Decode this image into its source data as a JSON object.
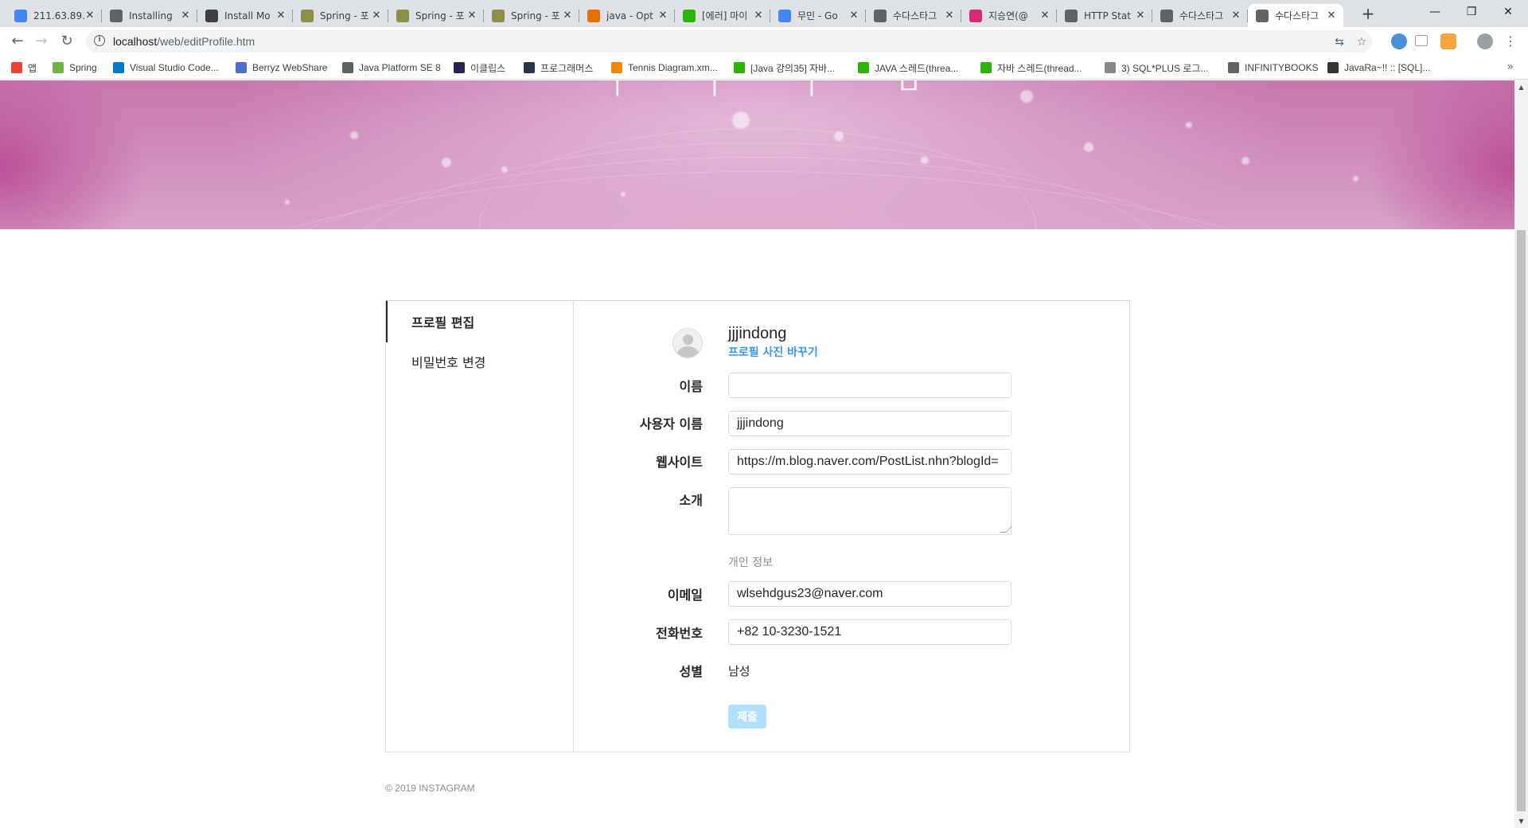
{
  "browser": {
    "tabs": [
      {
        "title": "211.63.89.",
        "icon": "chrome-icon",
        "color": "#4285f4"
      },
      {
        "title": "Installing",
        "icon": "globe-icon",
        "color": "#5f6368"
      },
      {
        "title": "Install Mo",
        "icon": "mongodb-icon",
        "color": "#3f3f3f"
      },
      {
        "title": "Spring - 포",
        "icon": "spring-icon",
        "color": "#8b8f4a"
      },
      {
        "title": "Spring - 포",
        "icon": "spring-icon",
        "color": "#8b8f4a"
      },
      {
        "title": "Spring - 포",
        "icon": "spring-icon",
        "color": "#8b8f4a"
      },
      {
        "title": "java - Opt",
        "icon": "java-icon",
        "color": "#e76f00"
      },
      {
        "title": "[에러] 마이",
        "icon": "blog-icon",
        "color": "#2db400"
      },
      {
        "title": "무민 - Go",
        "icon": "google-icon",
        "color": "#4285f4"
      },
      {
        "title": "수다스타그",
        "icon": "globe-icon",
        "color": "#5f6368"
      },
      {
        "title": "지승연(@",
        "icon": "instagram-icon",
        "color": "#d62976"
      },
      {
        "title": "HTTP Stat",
        "icon": "globe-icon",
        "color": "#5f6368"
      },
      {
        "title": "수다스타그",
        "icon": "globe-icon",
        "color": "#5f6368"
      },
      {
        "title": "수다스타그",
        "icon": "globe-icon",
        "color": "#5f6368",
        "active": true
      }
    ],
    "url_host": "localhost",
    "url_path": "/web/editProfile.htm",
    "bookmarks": [
      {
        "label": "앱",
        "color": "#ea4335"
      },
      {
        "label": "Spring",
        "color": "#6db33f"
      },
      {
        "label": "Visual Studio Code...",
        "color": "#007acc"
      },
      {
        "label": "Berryz WebShare",
        "color": "#4a6fd0"
      },
      {
        "label": "Java Platform SE 8",
        "color": "#5f6368"
      },
      {
        "label": "이클립스",
        "color": "#2c2255"
      },
      {
        "label": "프로그래머스",
        "color": "#263747"
      },
      {
        "label": "Tennis Diagram.xm...",
        "color": "#f08705"
      },
      {
        "label": "[Java 강의35] 자바...",
        "color": "#2db400"
      },
      {
        "label": "JAVA 스레드(threa...",
        "color": "#2db400"
      },
      {
        "label": "자바 스레드(thread...",
        "color": "#2db400"
      },
      {
        "label": "3) SQL*PLUS 로그...",
        "color": "#888888"
      },
      {
        "label": "INFINITYBOOKS",
        "color": "#5f6368"
      },
      {
        "label": "JavaRa~!! :: [SQL]...",
        "color": "#333333"
      }
    ]
  },
  "sidebar": {
    "items": [
      {
        "label": "프로필 편집",
        "active": true
      },
      {
        "label": "비밀번호 변경",
        "active": false
      }
    ]
  },
  "profile": {
    "username": "jjjindong",
    "change_photo": "프로필 사진 바꾸기"
  },
  "form": {
    "name_label": "이름",
    "name_value": "",
    "username_label": "사용자 이름",
    "username_value": "jjjindong",
    "website_label": "웹사이트",
    "website_value": "https://m.blog.naver.com/PostList.nhn?blogId=",
    "bio_label": "소개",
    "bio_value": "",
    "section_private": "개인 정보",
    "email_label": "이메일",
    "email_value": "wlsehdgus23@naver.com",
    "phone_label": "전화번호",
    "phone_value": "+82 10-3230-1521",
    "gender_label": "성별",
    "gender_value": "남성",
    "submit_label": "제출"
  },
  "footer": {
    "copyright": "© 2019 INSTAGRAM"
  },
  "colors": {
    "link_blue": "#3897f0",
    "submit_disabled": "#b2dffc",
    "border": "#dbdbdb"
  }
}
